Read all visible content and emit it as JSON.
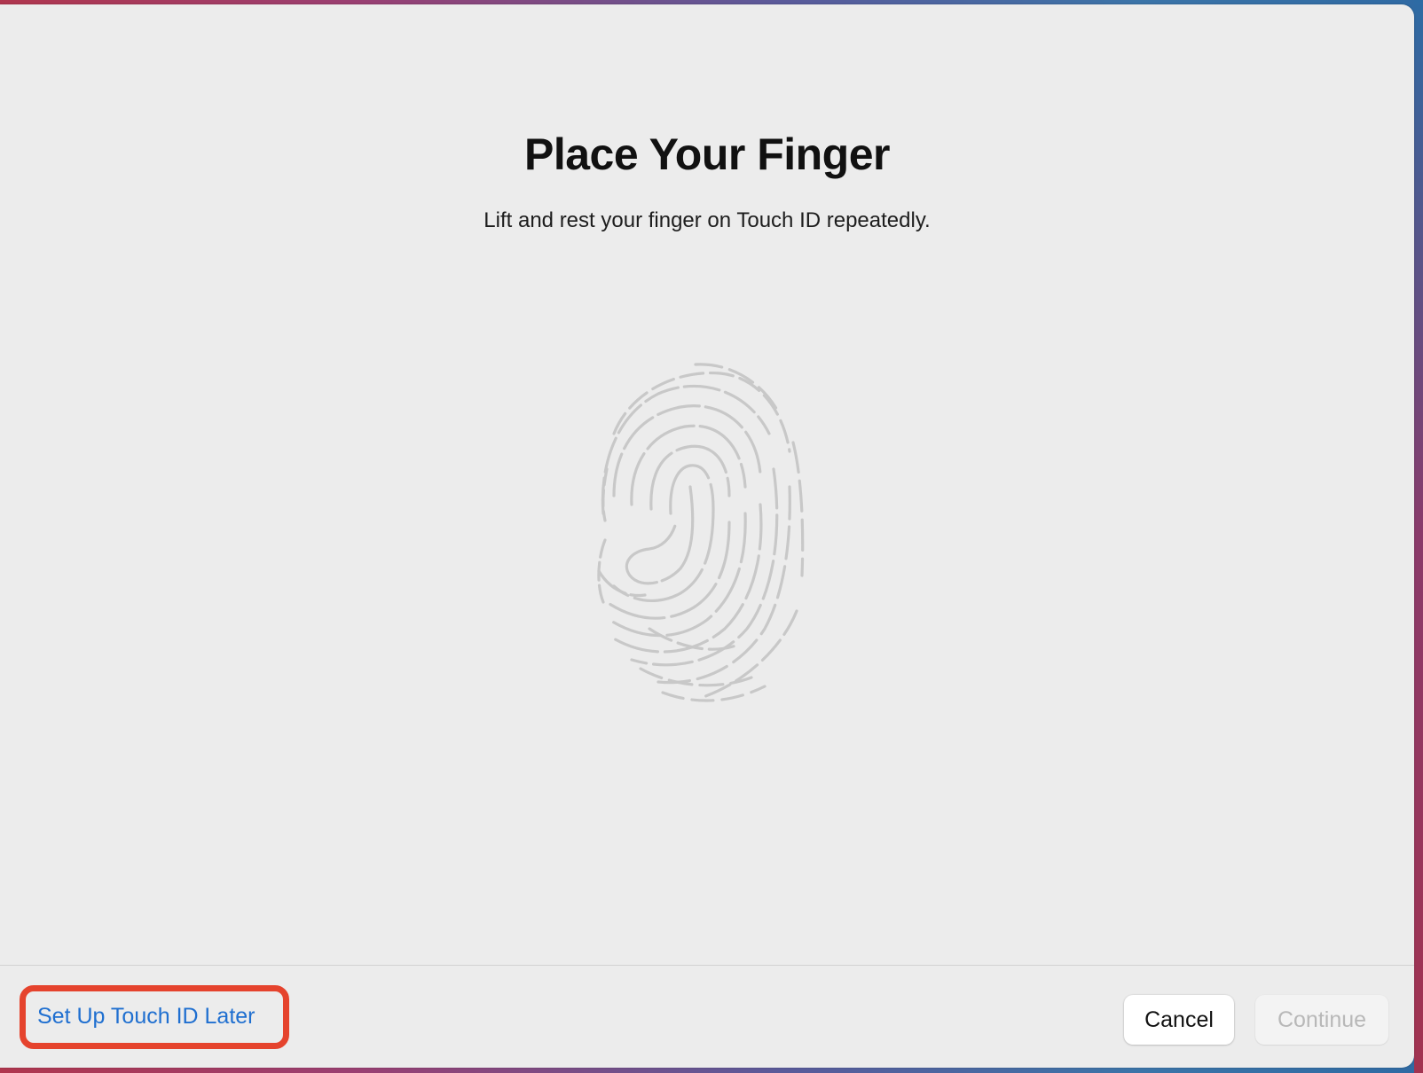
{
  "dialog": {
    "title": "Place Your Finger",
    "subtitle": "Lift and rest your finger on Touch ID repeatedly.",
    "fingerprint_icon": "fingerprint-icon",
    "fingerprint_color": "#c8c8c8"
  },
  "footer": {
    "later_label": "Set Up Touch ID Later",
    "cancel_label": "Cancel",
    "continue_label": "Continue",
    "continue_enabled": false,
    "link_color": "#1f6fd0",
    "highlight_color": "#e5432d"
  }
}
